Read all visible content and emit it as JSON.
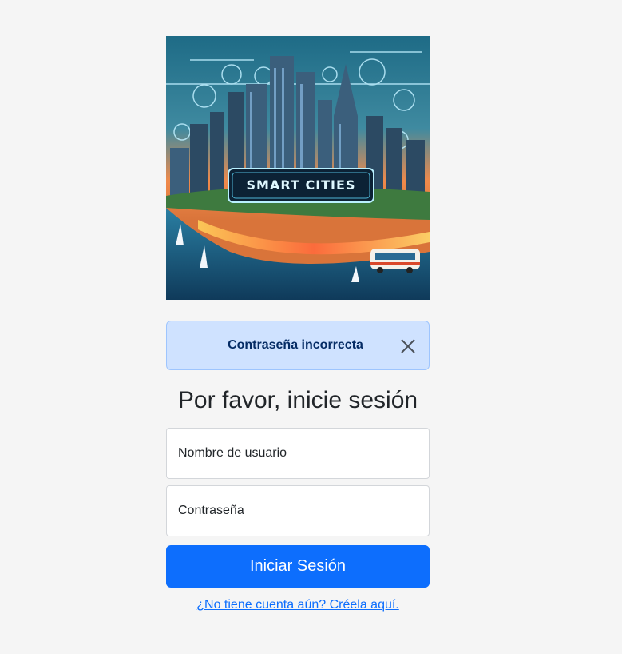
{
  "hero": {
    "banner_text": "SMART CITIES",
    "alt": "Smart Cities"
  },
  "alert": {
    "message": "Contraseña incorrecta",
    "close_icon": "close-icon",
    "bg_color": "#cfe2ff",
    "text_color": "#052c65"
  },
  "login": {
    "title": "Por favor, inicie sesión",
    "username_placeholder": "Nombre de usuario",
    "password_placeholder": "Contraseña",
    "submit_label": "Iniciar Sesión",
    "signup_link": "¿No tiene cuenta aún? Créela aquí.",
    "accent_color": "#0d6efd"
  }
}
